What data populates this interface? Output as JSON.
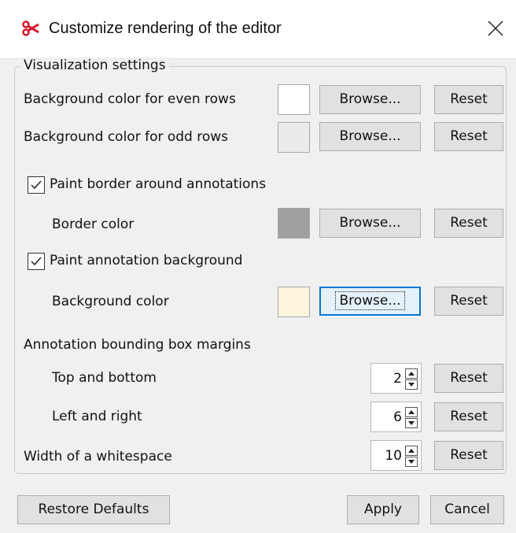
{
  "window": {
    "title": "Customize rendering of the editor",
    "app_icon": "scissors-app-icon",
    "close_icon": "close-icon"
  },
  "group": {
    "title": "Visualization settings"
  },
  "rows": {
    "even_rows": {
      "label": "Background color for even rows",
      "color": "#ffffff",
      "browse_label": "Browse...",
      "reset_label": "Reset"
    },
    "odd_rows": {
      "label": "Background color for odd rows",
      "color": "#ebebeb",
      "browse_label": "Browse...",
      "reset_label": "Reset"
    },
    "paint_border": {
      "label": "Paint border around annotations",
      "checked": true
    },
    "border_color": {
      "label": "Border color",
      "color": "#a0a0a0",
      "browse_label": "Browse...",
      "reset_label": "Reset"
    },
    "paint_background": {
      "label": "Paint annotation background",
      "checked": true
    },
    "background_color": {
      "label": "Background color",
      "color": "#fef6dc",
      "browse_label": "Browse...",
      "reset_label": "Reset"
    }
  },
  "margins": {
    "heading": "Annotation bounding box margins",
    "top_bottom": {
      "label": "Top and bottom",
      "value": "2",
      "reset_label": "Reset"
    },
    "left_right": {
      "label": "Left and right",
      "value": "6",
      "reset_label": "Reset"
    }
  },
  "whitespace": {
    "label": "Width of a whitespace",
    "value": "10",
    "reset_label": "Reset"
  },
  "footer": {
    "restore_defaults": "Restore Defaults",
    "apply": "Apply",
    "cancel": "Cancel"
  },
  "colors": {
    "focus_accent": "#0078d7",
    "app_icon_red": "#d6172b"
  }
}
